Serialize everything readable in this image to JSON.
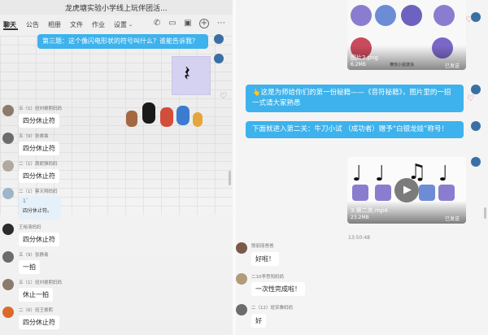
{
  "window": {
    "title": "龙虎塘实验小学线上玩伴团活..."
  },
  "tabs": [
    "聊天",
    "公告",
    "相册",
    "文件",
    "作业",
    "设置"
  ],
  "left": {
    "question": "第三题：这个像闪电形状的符号叫什么？谁能告诉我？",
    "rest_symbol": "𝄽",
    "messages": [
      {
        "sender": "五（1）班刘睿熙妈妈",
        "text": "四分休止符"
      },
      {
        "sender": "五（9）张睿熹",
        "text": "四分休止符"
      },
      {
        "sender": "二（1）周妮雅妈妈",
        "text": "四分休止符"
      },
      {
        "sender": "二（1）蔡天翔妈妈",
        "text": "四分休止符。",
        "quote": "1`"
      },
      {
        "sender": "王裕清妈妈",
        "text": "四分休止符"
      },
      {
        "sender": "五（9）张静熹",
        "text": "一拍"
      },
      {
        "sender": "五（1）班刘睿熙妈妈",
        "text": "休止一拍"
      },
      {
        "sender": "二（6）班王睿熙",
        "text": "四分休止符"
      }
    ]
  },
  "right": {
    "file1": {
      "name": "图片2.png",
      "size": "6.2MB",
      "status": "已发送",
      "caption": "横伐小鼠游泳"
    },
    "msg1": "👆这是为师给你们的第一份秘籍——《音符秘籍》，图片里的一招一式请大家熟悉",
    "msg2": "下面就进入第二关：牛刀小试 （成功者）赠予“白银龙娃”称号！",
    "video": {
      "name": "3.第二关.mp4",
      "size": "23.2MB",
      "status": "已发送"
    },
    "time": "13:50:48",
    "messages": [
      {
        "sender": "殷丽丽爸爸",
        "text": "好啦！"
      },
      {
        "sender": "二10李思阳妈妈",
        "text": "一次性完成啦！"
      },
      {
        "sender": "二（12）班宋雅妈妈",
        "text": "好"
      }
    ]
  },
  "colors": {
    "accent": "#3db2ec"
  }
}
